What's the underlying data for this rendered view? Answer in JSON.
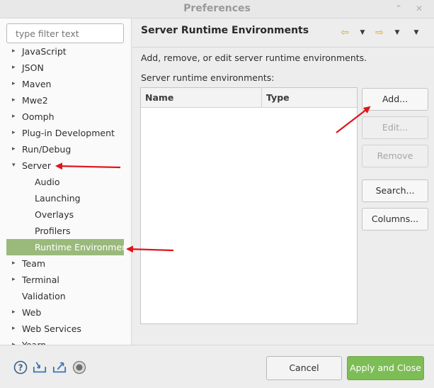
{
  "window": {
    "title": "Preferences",
    "restore_glyph": "⌃",
    "close_glyph": "✕"
  },
  "sidebar": {
    "filter_placeholder": "type filter text",
    "items": [
      {
        "label": "JavaScript",
        "level": 0,
        "expander": "▸"
      },
      {
        "label": "JSON",
        "level": 0,
        "expander": "▸"
      },
      {
        "label": "Maven",
        "level": 0,
        "expander": "▸"
      },
      {
        "label": "Mwe2",
        "level": 0,
        "expander": "▸"
      },
      {
        "label": "Oomph",
        "level": 0,
        "expander": "▸"
      },
      {
        "label": "Plug-in Development",
        "level": 0,
        "expander": "▸"
      },
      {
        "label": "Run/Debug",
        "level": 0,
        "expander": "▸"
      },
      {
        "label": "Server",
        "level": 0,
        "expander": "▾"
      },
      {
        "label": "Audio",
        "level": 1
      },
      {
        "label": "Launching",
        "level": 1
      },
      {
        "label": "Overlays",
        "level": 1
      },
      {
        "label": "Profilers",
        "level": 1
      },
      {
        "label": "Runtime Environments",
        "level": 1,
        "selected": true
      },
      {
        "label": "Team",
        "level": 0,
        "expander": "▸"
      },
      {
        "label": "Terminal",
        "level": 0,
        "expander": "▸"
      },
      {
        "label": "Validation",
        "level": 0
      },
      {
        "label": "Web",
        "level": 0,
        "expander": "▸"
      },
      {
        "label": "Web Services",
        "level": 0,
        "expander": "▸"
      },
      {
        "label": "Yearn",
        "level": 0,
        "expander": "▸"
      }
    ]
  },
  "page": {
    "title": "Server Runtime Environments",
    "description": "Add, remove, or edit server runtime environments.",
    "list_label": "Server runtime environments:",
    "columns": [
      "Name",
      "Type"
    ],
    "nav": {
      "back_glyph": "⇦",
      "forward_glyph": "⇨",
      "menu_glyph": "▼"
    },
    "buttons": {
      "add": "Add...",
      "edit": "Edit...",
      "remove": "Remove",
      "search": "Search...",
      "columns": "Columns..."
    }
  },
  "footer": {
    "help_glyph": "?",
    "cancel": "Cancel",
    "apply_close": "Apply and Close"
  },
  "colors": {
    "selection": "#9aba7c",
    "apply_button": "#7dbd55",
    "annotation_arrow": "#e0141a",
    "nav_arrow": "#e2a52b"
  }
}
